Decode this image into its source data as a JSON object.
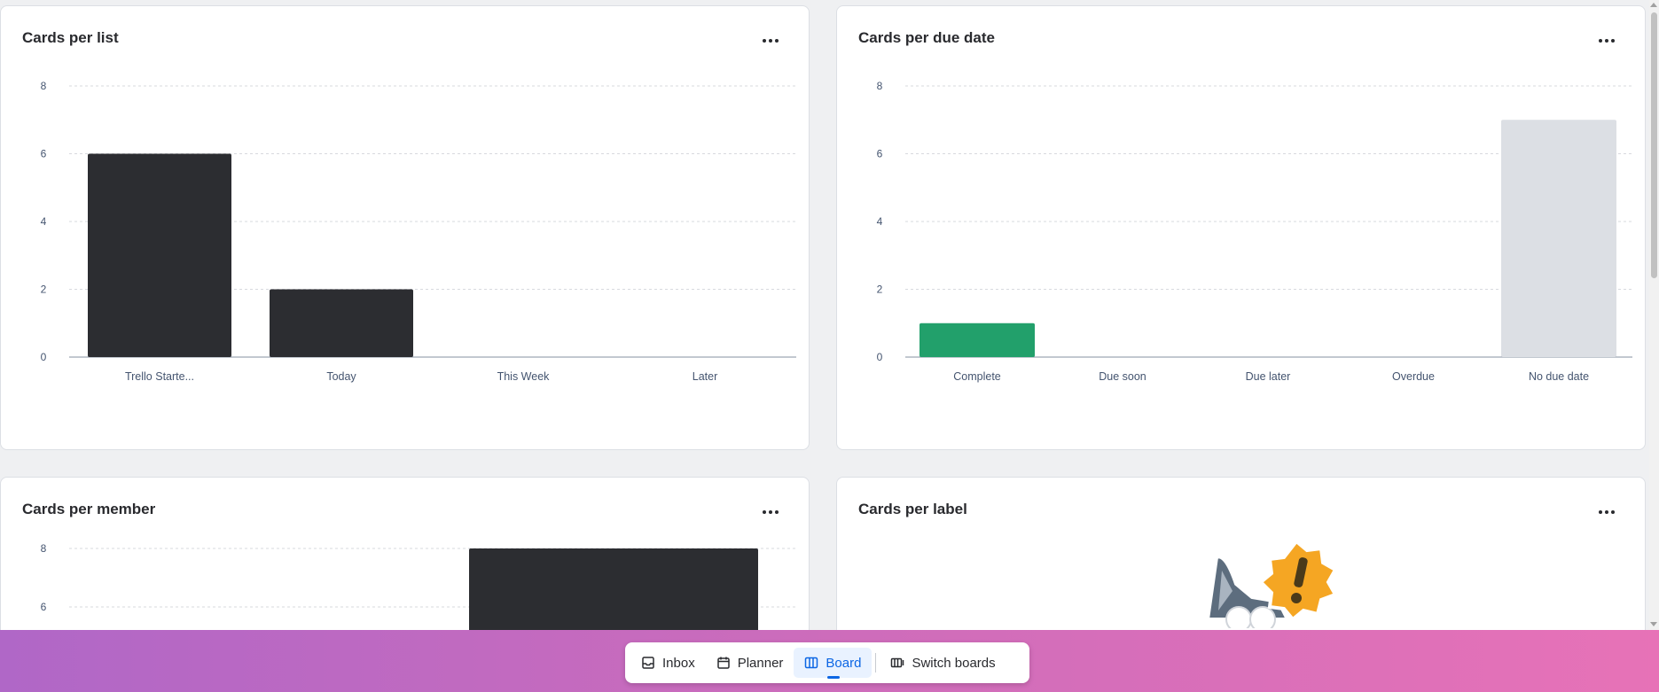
{
  "cards": {
    "per_list": {
      "title": "Cards per list",
      "more_label": "More options"
    },
    "per_due_date": {
      "title": "Cards per due date"
    },
    "per_member": {
      "title": "Cards per member"
    },
    "per_label": {
      "title": "Cards per label"
    }
  },
  "chart_data": [
    {
      "type": "bar",
      "title": "Cards per list",
      "categories": [
        "Trello Starte...",
        "Today",
        "This Week",
        "Later"
      ],
      "values": [
        6,
        2,
        0,
        0
      ],
      "colors": [
        "#2c2d31",
        "#2c2d31",
        "#2c2d31",
        "#2c2d31"
      ],
      "yticks": [
        0,
        2,
        4,
        6,
        8
      ],
      "ylim": [
        0,
        8
      ],
      "grid": true
    },
    {
      "type": "bar",
      "title": "Cards per due date",
      "categories": [
        "Complete",
        "Due soon",
        "Due later",
        "Overdue",
        "No due date"
      ],
      "values": [
        1,
        0,
        0,
        0,
        7
      ],
      "colors": [
        "#22a06b",
        "#e2b203",
        "#f5cd47",
        "#c9372c",
        "#dcdfe4"
      ],
      "yticks": [
        0,
        2,
        4,
        6,
        8
      ],
      "ylim": [
        0,
        8
      ],
      "grid": true
    },
    {
      "type": "bar",
      "title": "Cards per member",
      "values": [
        8
      ],
      "colors": [
        "#2c2d31"
      ],
      "yticks": [
        6,
        8
      ],
      "ylim": [
        0,
        8
      ],
      "grid": true
    }
  ],
  "bottom_nav": {
    "inbox": "Inbox",
    "planner": "Planner",
    "board": "Board",
    "switch_boards": "Switch boards",
    "active": "board"
  }
}
